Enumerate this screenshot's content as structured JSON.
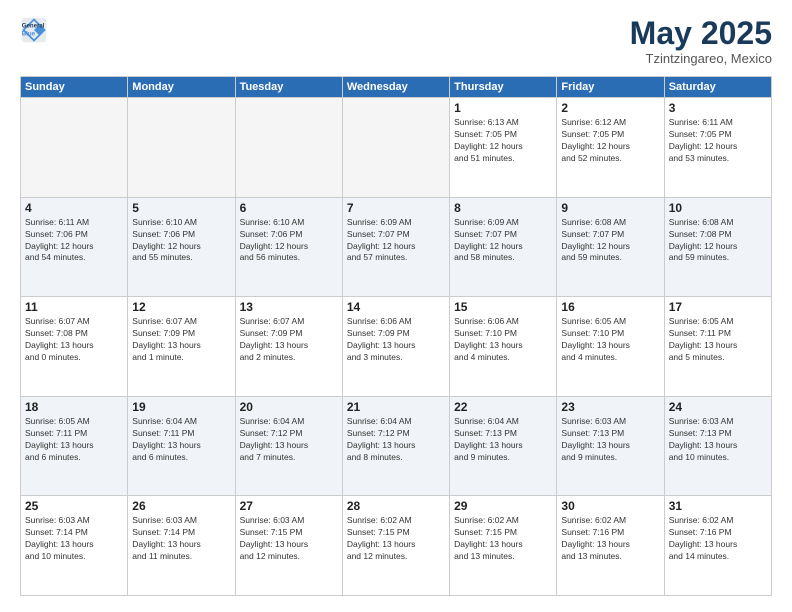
{
  "header": {
    "logo_line1": "General",
    "logo_line2": "Blue",
    "month": "May 2025",
    "location": "Tzintzingareo, Mexico"
  },
  "weekdays": [
    "Sunday",
    "Monday",
    "Tuesday",
    "Wednesday",
    "Thursday",
    "Friday",
    "Saturday"
  ],
  "weeks": [
    [
      {
        "day": "",
        "info": ""
      },
      {
        "day": "",
        "info": ""
      },
      {
        "day": "",
        "info": ""
      },
      {
        "day": "",
        "info": ""
      },
      {
        "day": "1",
        "info": "Sunrise: 6:13 AM\nSunset: 7:05 PM\nDaylight: 12 hours\nand 51 minutes."
      },
      {
        "day": "2",
        "info": "Sunrise: 6:12 AM\nSunset: 7:05 PM\nDaylight: 12 hours\nand 52 minutes."
      },
      {
        "day": "3",
        "info": "Sunrise: 6:11 AM\nSunset: 7:05 PM\nDaylight: 12 hours\nand 53 minutes."
      }
    ],
    [
      {
        "day": "4",
        "info": "Sunrise: 6:11 AM\nSunset: 7:06 PM\nDaylight: 12 hours\nand 54 minutes."
      },
      {
        "day": "5",
        "info": "Sunrise: 6:10 AM\nSunset: 7:06 PM\nDaylight: 12 hours\nand 55 minutes."
      },
      {
        "day": "6",
        "info": "Sunrise: 6:10 AM\nSunset: 7:06 PM\nDaylight: 12 hours\nand 56 minutes."
      },
      {
        "day": "7",
        "info": "Sunrise: 6:09 AM\nSunset: 7:07 PM\nDaylight: 12 hours\nand 57 minutes."
      },
      {
        "day": "8",
        "info": "Sunrise: 6:09 AM\nSunset: 7:07 PM\nDaylight: 12 hours\nand 58 minutes."
      },
      {
        "day": "9",
        "info": "Sunrise: 6:08 AM\nSunset: 7:07 PM\nDaylight: 12 hours\nand 59 minutes."
      },
      {
        "day": "10",
        "info": "Sunrise: 6:08 AM\nSunset: 7:08 PM\nDaylight: 12 hours\nand 59 minutes."
      }
    ],
    [
      {
        "day": "11",
        "info": "Sunrise: 6:07 AM\nSunset: 7:08 PM\nDaylight: 13 hours\nand 0 minutes."
      },
      {
        "day": "12",
        "info": "Sunrise: 6:07 AM\nSunset: 7:09 PM\nDaylight: 13 hours\nand 1 minute."
      },
      {
        "day": "13",
        "info": "Sunrise: 6:07 AM\nSunset: 7:09 PM\nDaylight: 13 hours\nand 2 minutes."
      },
      {
        "day": "14",
        "info": "Sunrise: 6:06 AM\nSunset: 7:09 PM\nDaylight: 13 hours\nand 3 minutes."
      },
      {
        "day": "15",
        "info": "Sunrise: 6:06 AM\nSunset: 7:10 PM\nDaylight: 13 hours\nand 4 minutes."
      },
      {
        "day": "16",
        "info": "Sunrise: 6:05 AM\nSunset: 7:10 PM\nDaylight: 13 hours\nand 4 minutes."
      },
      {
        "day": "17",
        "info": "Sunrise: 6:05 AM\nSunset: 7:11 PM\nDaylight: 13 hours\nand 5 minutes."
      }
    ],
    [
      {
        "day": "18",
        "info": "Sunrise: 6:05 AM\nSunset: 7:11 PM\nDaylight: 13 hours\nand 6 minutes."
      },
      {
        "day": "19",
        "info": "Sunrise: 6:04 AM\nSunset: 7:11 PM\nDaylight: 13 hours\nand 6 minutes."
      },
      {
        "day": "20",
        "info": "Sunrise: 6:04 AM\nSunset: 7:12 PM\nDaylight: 13 hours\nand 7 minutes."
      },
      {
        "day": "21",
        "info": "Sunrise: 6:04 AM\nSunset: 7:12 PM\nDaylight: 13 hours\nand 8 minutes."
      },
      {
        "day": "22",
        "info": "Sunrise: 6:04 AM\nSunset: 7:13 PM\nDaylight: 13 hours\nand 9 minutes."
      },
      {
        "day": "23",
        "info": "Sunrise: 6:03 AM\nSunset: 7:13 PM\nDaylight: 13 hours\nand 9 minutes."
      },
      {
        "day": "24",
        "info": "Sunrise: 6:03 AM\nSunset: 7:13 PM\nDaylight: 13 hours\nand 10 minutes."
      }
    ],
    [
      {
        "day": "25",
        "info": "Sunrise: 6:03 AM\nSunset: 7:14 PM\nDaylight: 13 hours\nand 10 minutes."
      },
      {
        "day": "26",
        "info": "Sunrise: 6:03 AM\nSunset: 7:14 PM\nDaylight: 13 hours\nand 11 minutes."
      },
      {
        "day": "27",
        "info": "Sunrise: 6:03 AM\nSunset: 7:15 PM\nDaylight: 13 hours\nand 12 minutes."
      },
      {
        "day": "28",
        "info": "Sunrise: 6:02 AM\nSunset: 7:15 PM\nDaylight: 13 hours\nand 12 minutes."
      },
      {
        "day": "29",
        "info": "Sunrise: 6:02 AM\nSunset: 7:15 PM\nDaylight: 13 hours\nand 13 minutes."
      },
      {
        "day": "30",
        "info": "Sunrise: 6:02 AM\nSunset: 7:16 PM\nDaylight: 13 hours\nand 13 minutes."
      },
      {
        "day": "31",
        "info": "Sunrise: 6:02 AM\nSunset: 7:16 PM\nDaylight: 13 hours\nand 14 minutes."
      }
    ]
  ]
}
